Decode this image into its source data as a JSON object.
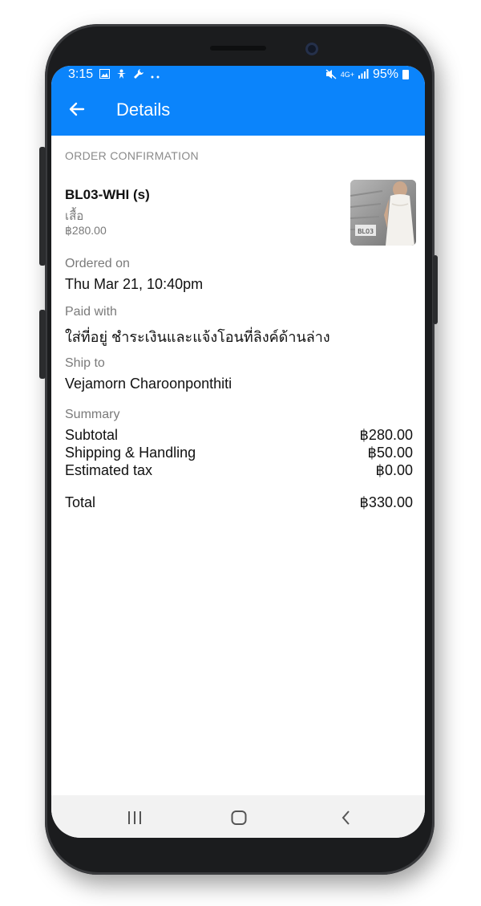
{
  "status_bar": {
    "time": "3:15",
    "network": "4G+",
    "battery": "95%",
    "icons": [
      "image-icon",
      "accessibility-icon",
      "wrench-icon",
      "more-dots-icon",
      "mute-icon",
      "signal-icon",
      "battery-icon"
    ]
  },
  "app_bar": {
    "title": "Details",
    "back_icon": "arrow-left-icon"
  },
  "order": {
    "section_title": "ORDER CONFIRMATION",
    "sku": "BL03-WHI (s)",
    "item_name": "เสื้อ",
    "item_price": "฿280.00",
    "thumb_label": "BL03",
    "ordered_on_label": "Ordered on",
    "ordered_on": "Thu Mar 21, 10:40pm",
    "paid_with_label": "Paid with",
    "paid_with": "ใส่ที่อยู่ ชำระเงินและแจ้งโอนที่ลิงค์ด้านล่าง",
    "ship_to_label": "Ship to",
    "ship_to": "Vejamorn Charoonponthiti"
  },
  "summary": {
    "label": "Summary",
    "subtotal_label": "Subtotal",
    "subtotal": "฿280.00",
    "shipping_label": "Shipping & Handling",
    "shipping": "฿50.00",
    "tax_label": "Estimated tax",
    "tax": "฿0.00",
    "total_label": "Total",
    "total": "฿330.00"
  },
  "nav_bar": {
    "icons": [
      "recent-apps-icon",
      "home-icon",
      "back-icon"
    ]
  },
  "colors": {
    "accent": "#0b84fb",
    "text_primary": "#111111",
    "text_secondary": "#7a7a7a"
  }
}
